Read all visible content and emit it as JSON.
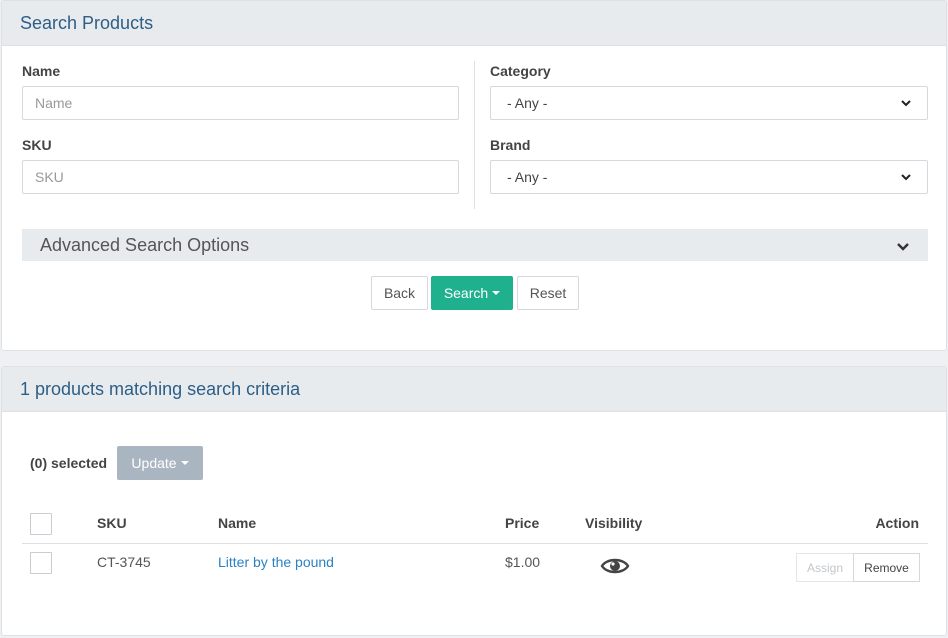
{
  "search_panel": {
    "title": "Search Products",
    "name_label": "Name",
    "name_placeholder": "Name",
    "name_value": "",
    "sku_label": "SKU",
    "sku_placeholder": "SKU",
    "sku_value": "",
    "category_label": "Category",
    "category_value": "- Any -",
    "brand_label": "Brand",
    "brand_value": "- Any -",
    "advanced_label": "Advanced Search Options",
    "back_label": "Back",
    "search_label": "Search",
    "reset_label": "Reset"
  },
  "results_panel": {
    "title": "1 products matching search criteria",
    "selected_label": "(0) selected",
    "update_label": "Update",
    "columns": {
      "sku": "SKU",
      "name": "Name",
      "price": "Price",
      "visibility": "Visibility",
      "action": "Action"
    },
    "rows": [
      {
        "sku": "CT-3745",
        "name": "Litter by the pound",
        "price": "$1.00",
        "visibility_icon": "eye-icon",
        "assign_label": "Assign",
        "remove_label": "Remove"
      }
    ]
  },
  "colors": {
    "heading_text": "#2d5e86",
    "primary": "#1fb08d",
    "link": "#2a82c4",
    "disabled": "#a9b6c1"
  }
}
